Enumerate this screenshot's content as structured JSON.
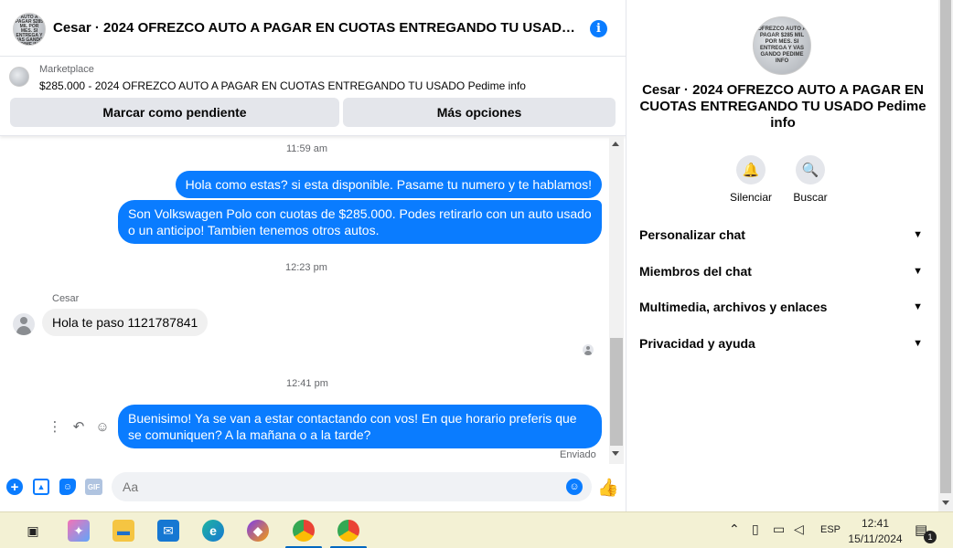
{
  "header": {
    "title": "Cesar · 2024 OFREZCO AUTO A PAGAR EN CUOTAS ENTREGANDO TU USADO Pedime info",
    "avatar_text": "OFREZCO AUTO A PAGAR $285 MIL POR MES. SI ENTREGA Y VAS GANDO PEDIME INFO"
  },
  "listing": {
    "source": "Marketplace",
    "text": "$285.000 - 2024 OFREZCO AUTO A PAGAR EN CUOTAS ENTREGANDO TU USADO Pedime info",
    "pending_label": "Marcar como pendiente",
    "more_label": "Más opciones"
  },
  "messages": {
    "ts1": "11:59 am",
    "out1": "Hola como estas? si esta disponible. Pasame tu numero y te hablamos!",
    "out2": "Son Volkswagen Polo con cuotas de $285.000. Podes retirarlo con un auto usado o un anticipo! Tambien tenemos otros autos.",
    "ts2": "12:23 pm",
    "sender": "Cesar",
    "in1": "Hola te paso 1121787841",
    "ts3": "12:41 pm",
    "out3": "Buenisimo! Ya se van a estar contactando con vos! En que horario preferis que se comuniquen? A la mañana o a la tarde?",
    "status": "Enviado"
  },
  "composer": {
    "placeholder": "Aa",
    "gif_label": "GIF"
  },
  "details": {
    "title": "Cesar · 2024 OFREZCO AUTO A PAGAR EN CUOTAS ENTREGANDO TU USADO Pedime info",
    "mute_label": "Silenciar",
    "search_label": "Buscar",
    "sections": [
      "Personalizar chat",
      "Miembros del chat",
      "Multimedia, archivos y enlaces",
      "Privacidad y ayuda"
    ]
  },
  "taskbar": {
    "lang": "ESP",
    "time": "12:41",
    "date": "15/11/2024",
    "notif_count": "1"
  },
  "colors": {
    "accent": "#0a7cff",
    "bubble_in": "#f0f0f0",
    "taskbar": "#f3f1d4"
  }
}
